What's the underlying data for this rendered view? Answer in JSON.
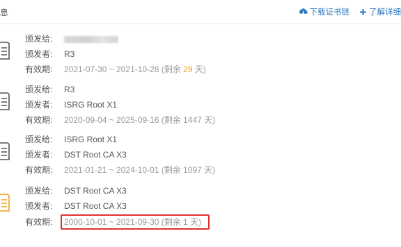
{
  "header": {
    "title": "息",
    "download_chain": "下载证书链",
    "learn_more": "了解详细"
  },
  "labels": {
    "issued_to": "颁发给:",
    "issuer": "颁发者:",
    "validity": "有效期:"
  },
  "certs": [
    {
      "issued_to": "",
      "issuer": "R3",
      "validity": "2021-07-30 ~ 2021-10-28",
      "remaining_prefix": "(剩余 ",
      "remaining_days": "29",
      "remaining_suffix": " 天)",
      "icon": "certificate-icon",
      "icon_color": "#555555"
    },
    {
      "issued_to": "R3",
      "issuer": "ISRG Root X1",
      "validity": "2020-09-04 ~ 2025-09-16",
      "remaining_text": "(剩余 1447 天)",
      "icon": "certificate-icon",
      "icon_color": "#555555"
    },
    {
      "issued_to": "ISRG Root X1",
      "issuer": "DST Root CA X3",
      "validity": "2021-01-21 ~ 2024-10-01",
      "remaining_text": "(剩余 1097 天)",
      "icon": "certificate-icon",
      "icon_color": "#555555"
    },
    {
      "issued_to": "DST Root CA X3",
      "issuer": "DST Root CA X3",
      "validity": "2000-10-01 ~ 2021-09-30",
      "remaining_text": "(剩余 1 天)",
      "icon": "certificate-warning-icon",
      "icon_color": "#f0a020"
    }
  ],
  "colors": {
    "link": "#2b78c2",
    "warning": "#f0a020",
    "highlight_border": "#e03030"
  }
}
